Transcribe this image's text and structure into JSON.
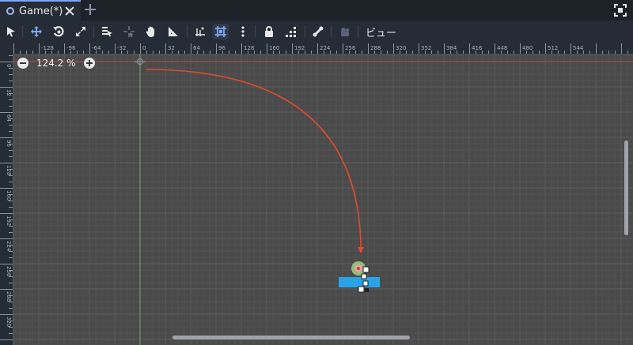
{
  "tab": {
    "title": "Game(*)"
  },
  "toolbar": {
    "tools": [
      "select-icon",
      "move-icon",
      "rotate-icon",
      "scale-icon",
      "list-select-icon",
      "pivot-icon",
      "pan-icon",
      "ruler-icon",
      "smart-snap-icon",
      "grid-snap-icon",
      "more-icon",
      "lock-icon",
      "group-icon",
      "skeleton-icon",
      "camera-icon"
    ],
    "view_label": "ビュー"
  },
  "zoom": {
    "value": "124.2 %"
  },
  "ruler": {
    "top_labels": [
      "-128",
      "-96",
      "-64",
      "-32",
      "0",
      "32",
      "64",
      "96",
      "128",
      "160",
      "192",
      "224",
      "256",
      "288",
      "320",
      "352",
      "384",
      "416",
      "448",
      "480",
      "512",
      "544"
    ],
    "left_labels": [
      "0",
      "32",
      "64",
      "96",
      "128",
      "160",
      "192",
      "224",
      "256",
      "288",
      "320"
    ]
  },
  "colors": {
    "accent": "#7aa7ff",
    "curve": "#e04a2e",
    "platform": "#29a3e8",
    "grid": "#585858",
    "viewport": "#4a4a4a"
  }
}
